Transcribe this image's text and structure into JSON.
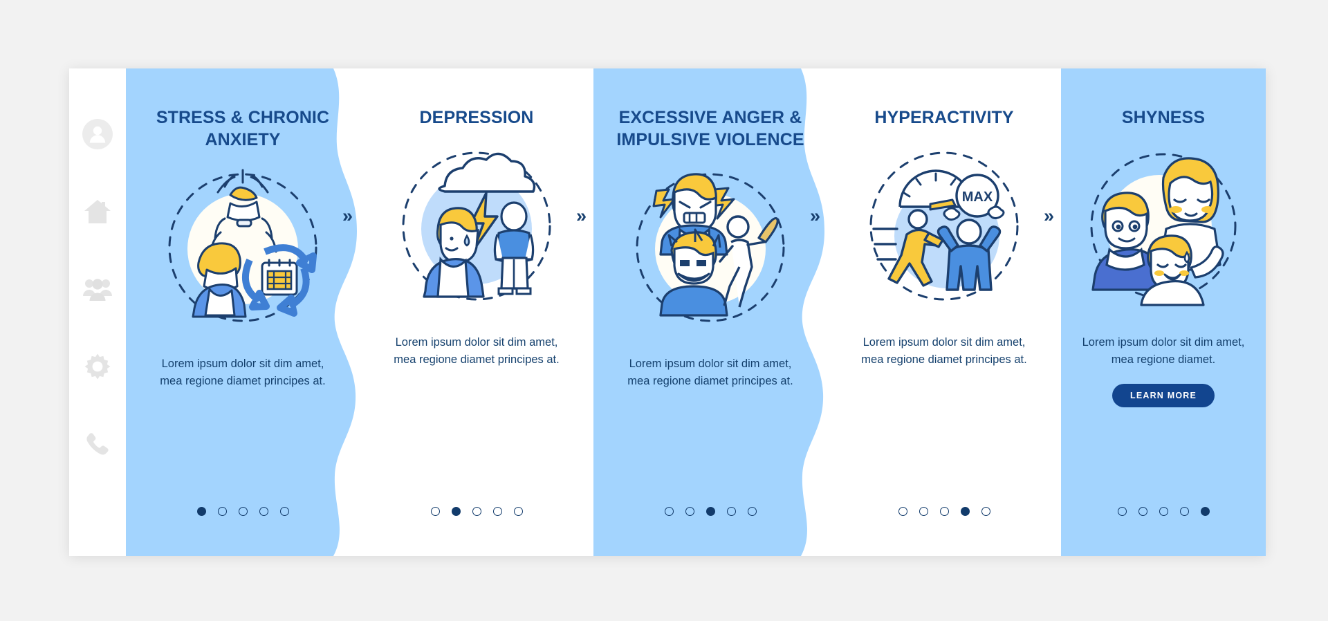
{
  "theme": {
    "page_background": "#f2f2f2",
    "card_background": "#ffffff",
    "panel_blue": "#a3d4fe",
    "panel_white": "#ffffff",
    "title_color": "#174a8b",
    "body_color": "#14406d",
    "dot_color": "#123b6b",
    "button_fill": "#12458f",
    "button_text": "#ffffff",
    "accent_yellow": "#f9c93c",
    "accent_blue": "#4a8fe0",
    "sidebar_icon_color": "#e2e2e2"
  },
  "sidebar": {
    "items": [
      {
        "icon": "user-avatar-icon",
        "name": "sidebar-item-profile"
      },
      {
        "icon": "home-icon",
        "name": "sidebar-item-home"
      },
      {
        "icon": "group-people-icon",
        "name": "sidebar-item-community"
      },
      {
        "icon": "gear-icon",
        "name": "sidebar-item-settings"
      },
      {
        "icon": "phone-icon",
        "name": "sidebar-item-contact"
      }
    ]
  },
  "separator": {
    "glyph": "»",
    "count": 4
  },
  "panels": [
    {
      "title": "STRESS & CHRONIC ANXIETY",
      "body": "Lorem ipsum dolor sit dim amet, mea regione diamet principes at.",
      "illustration": "stressed-person-calendar-cycle-icon",
      "background": "blue",
      "dots_total": 5,
      "dot_active": 1,
      "has_button": false,
      "button_label": null
    },
    {
      "title": "DEPRESSION",
      "body": "Lorem ipsum dolor sit dim amet, mea regione diamet principes at.",
      "illustration": "rain-cloud-sad-person-icon",
      "background": "white",
      "dots_total": 5,
      "dot_active": 2,
      "has_button": false,
      "button_label": null
    },
    {
      "title": "EXCESSIVE ANGER & IMPULSIVE VIOLENCE",
      "body": "Lorem ipsum dolor sit dim amet, mea regione diamet principes at.",
      "illustration": "angry-face-lightning-bat-icon",
      "background": "blue",
      "dots_total": 5,
      "dot_active": 3,
      "has_button": false,
      "button_label": null
    },
    {
      "title": "HYPERACTIVITY",
      "body": "Lorem ipsum dolor sit dim amet, mea regione diamet principes at.",
      "illustration": "speedometer-max-running-person-icon",
      "background": "white",
      "dots_total": 5,
      "dot_active": 4,
      "has_button": false,
      "button_label": null
    },
    {
      "title": "SHYNESS",
      "body": "Lorem ipsum dolor sit dim amet, mea regione diamet.",
      "illustration": "shy-family-group-icon",
      "background": "blue",
      "dots_total": 5,
      "dot_active": 5,
      "has_button": true,
      "button_label": "LEARN MORE"
    }
  ],
  "illustration_labels": {
    "speedometer_max": "MAX"
  }
}
